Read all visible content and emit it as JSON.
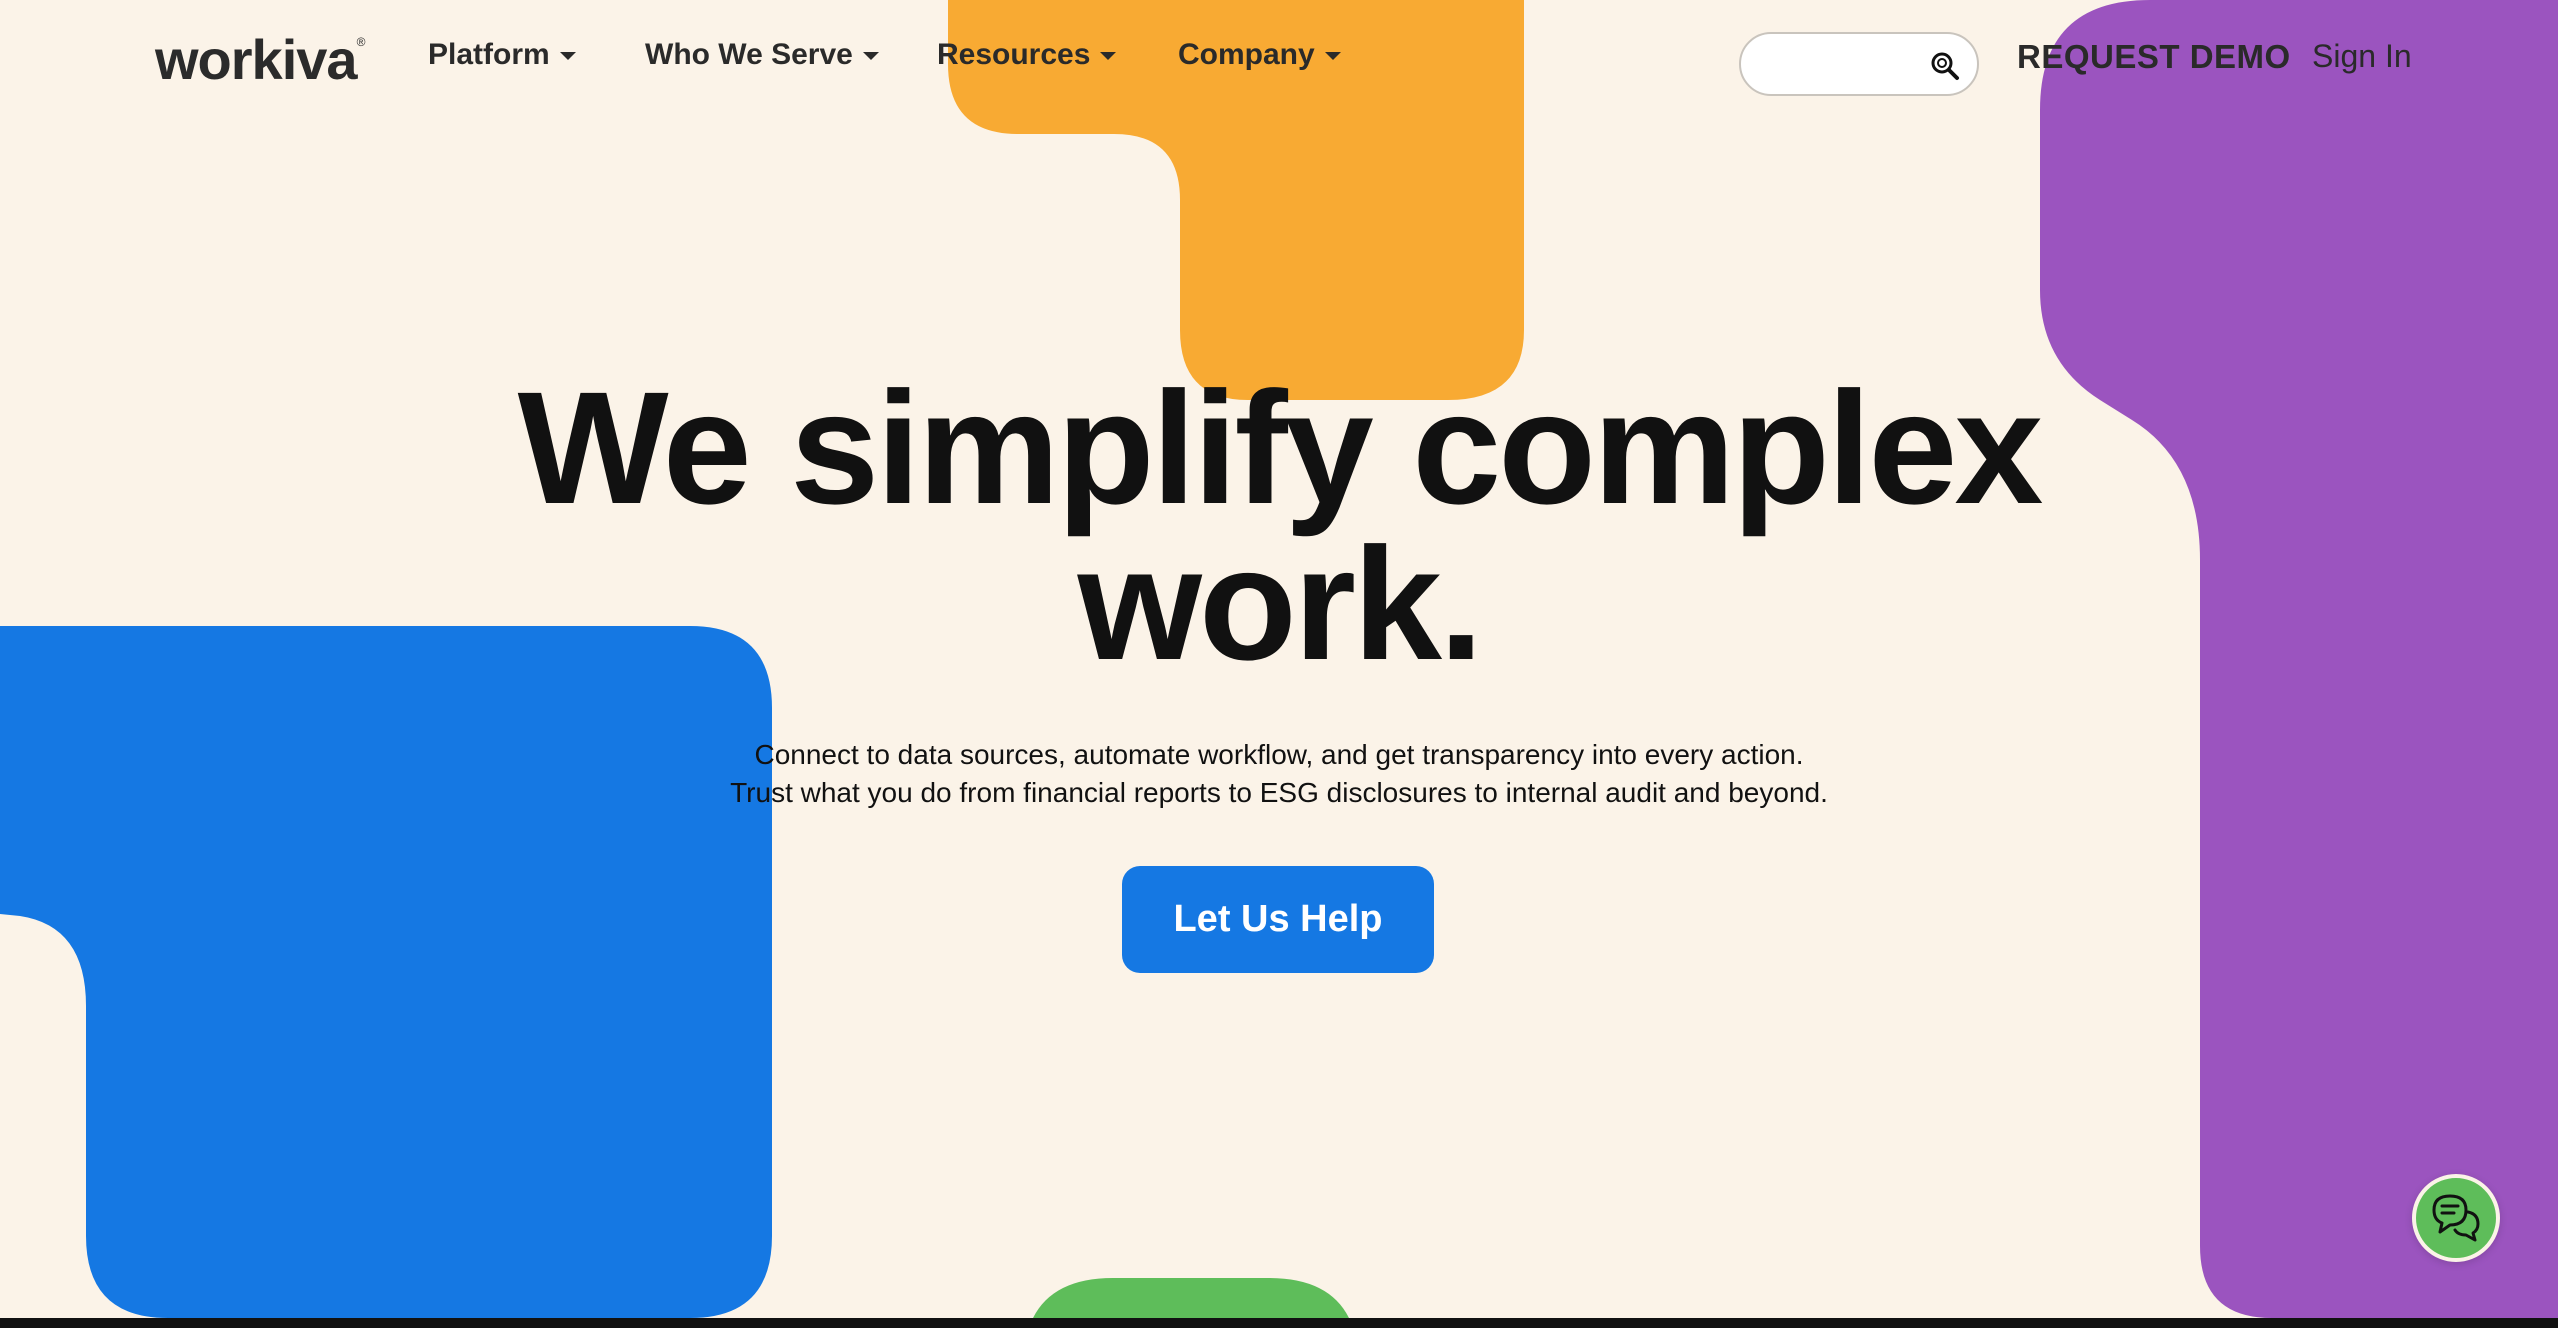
{
  "brand": {
    "logo_text": "workiva",
    "registered_mark": "®"
  },
  "nav": {
    "items": [
      {
        "label": "Platform",
        "icon": "chevron-down-icon"
      },
      {
        "label": "Who We Serve",
        "icon": "chevron-down-icon"
      },
      {
        "label": "Resources",
        "icon": "chevron-down-icon"
      },
      {
        "label": "Company",
        "icon": "chevron-down-icon"
      }
    ],
    "search": {
      "placeholder": "",
      "value": "",
      "icon": "search-icon"
    },
    "request_demo_label": "REQUEST DEMO",
    "sign_in_label": "Sign In"
  },
  "hero": {
    "title_line1": "We simplify complex",
    "title_line2": "work.",
    "subtitle_line1": "Connect to data sources, automate workflow, and get transparency into every action.",
    "subtitle_line2": "Trust what you do from financial reports to ESG disclosures to internal audit and beyond.",
    "cta_label": "Let Us Help"
  },
  "chat": {
    "icon": "chat-bubbles-icon"
  },
  "colors": {
    "background": "#fbf3e8",
    "orange": "#f8aa33",
    "purple": "#9b54bf",
    "blue": "#1578e3",
    "green": "#5ebd5a",
    "text": "#111111"
  }
}
